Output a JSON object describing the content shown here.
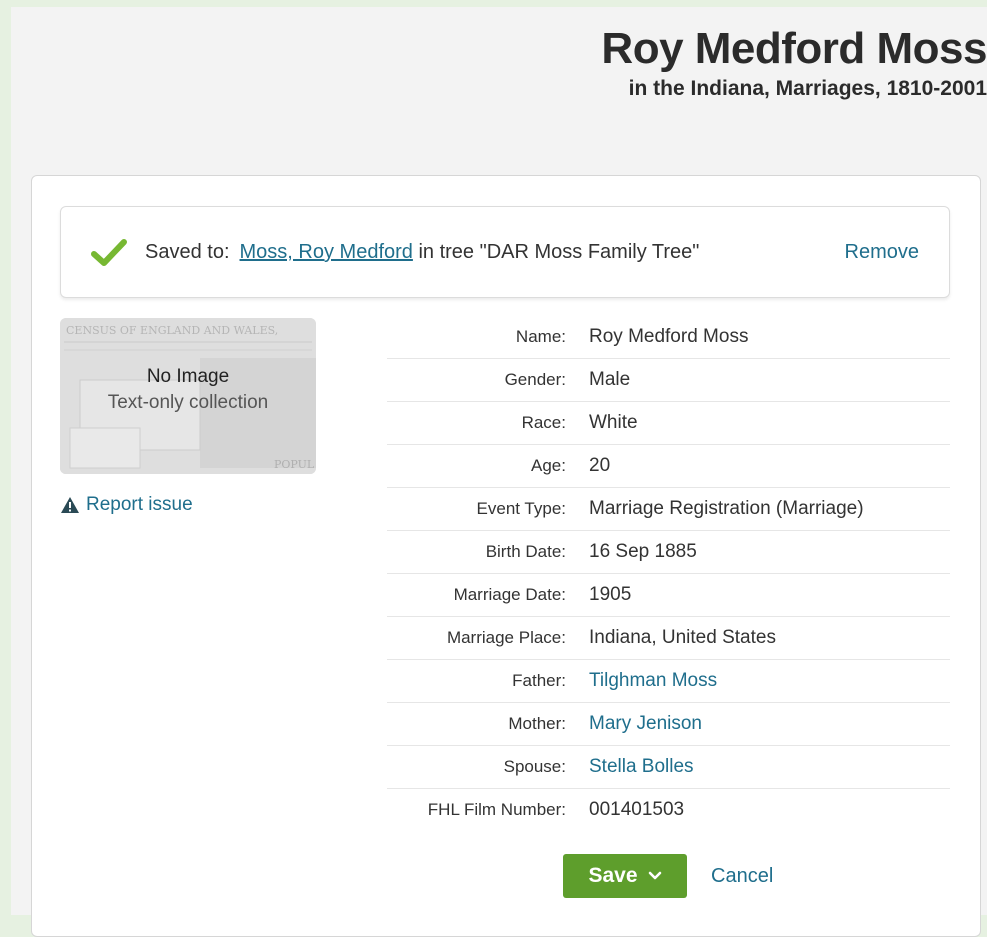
{
  "header": {
    "title": "Roy Medford Moss",
    "subtitle": "in the Indiana, Marriages, 1810-2001"
  },
  "saved": {
    "label": "Saved to:",
    "person_link": "Moss, Roy Medford",
    "tree_text": " in tree \"DAR Moss Family Tree\"",
    "remove_label": "Remove",
    "check_color": "#77b832"
  },
  "thumbnail": {
    "title": "No Image",
    "subtitle": "Text-only collection",
    "bg_text_1": "CENSUS OF ENGLAND AND WALES,",
    "bg_text_2": "POPUL"
  },
  "report_issue": "Report issue",
  "details": [
    {
      "label": "Name:",
      "value": "Roy Medford Moss",
      "is_link": false
    },
    {
      "label": "Gender:",
      "value": "Male",
      "is_link": false
    },
    {
      "label": "Race:",
      "value": "White",
      "is_link": false
    },
    {
      "label": "Age:",
      "value": "20",
      "is_link": false
    },
    {
      "label": "Event Type:",
      "value": "Marriage Registration (Marriage)",
      "is_link": false
    },
    {
      "label": "Birth Date:",
      "value": "16 Sep 1885",
      "is_link": false
    },
    {
      "label": "Marriage Date:",
      "value": "1905",
      "is_link": false
    },
    {
      "label": "Marriage Place:",
      "value": "Indiana, United States",
      "is_link": false
    },
    {
      "label": "Father:",
      "value": "Tilghman Moss",
      "is_link": true
    },
    {
      "label": "Mother:",
      "value": "Mary Jenison",
      "is_link": true
    },
    {
      "label": "Spouse:",
      "value": "Stella Bolles",
      "is_link": true
    },
    {
      "label": "FHL Film Number:",
      "value": "001401503",
      "is_link": false
    }
  ],
  "actions": {
    "save_label": "Save",
    "cancel_label": "Cancel",
    "save_color": "#5e9e2c"
  },
  "colors": {
    "link": "#1f6e8c",
    "page_bg": "#f3f3f3",
    "frame_bg": "#e6f1e1"
  }
}
